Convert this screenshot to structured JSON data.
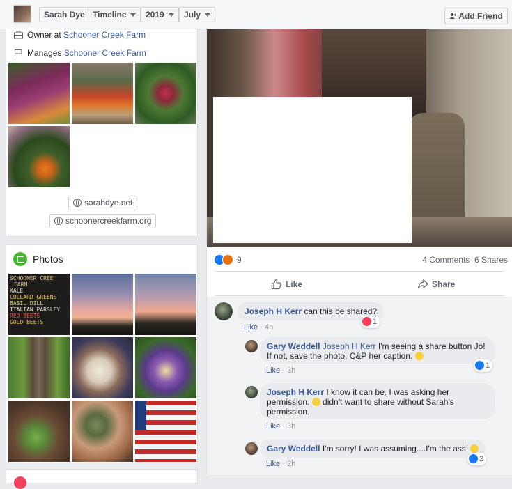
{
  "topbar": {
    "name": "Sarah Dye",
    "section": "Timeline",
    "year": "2019",
    "month": "July",
    "add_friend_label": "Add Friend"
  },
  "intro": {
    "owner_prefix": "Owner at",
    "owner_link": "Schooner Creek Farm",
    "manages_prefix": "Manages",
    "manages_link": "Schooner Creek Farm",
    "websites": [
      "sarahdye.net",
      "schoonercreekfarm.org"
    ]
  },
  "photos": {
    "title": "Photos",
    "sign_lines": [
      "SCHOONER CREE",
      "FARM",
      "KALE",
      "COLLARD GREENS",
      "BASIL  DILL",
      "ITALIAN PARSLEY",
      "RED BEETS",
      "GOLD BEETS"
    ]
  },
  "post": {
    "reaction_count": "9",
    "comments_count": "4 Comments",
    "shares_count": "6 Shares",
    "like_label": "Like",
    "share_label": "Share"
  },
  "comments": [
    {
      "author": "Joseph H Kerr",
      "text": "can this be shared?",
      "like_label": "Like",
      "time": "4h",
      "reaction_count": "1"
    },
    {
      "author": "Gary Weddell",
      "tag": "Joseph H Kerr",
      "line1_rest": "I'm seeing a share button Jo!",
      "line2": "If not, save the photo, C&P her caption.",
      "like_label": "Like",
      "time": "3h",
      "reaction_count": "1"
    },
    {
      "author": "Joseph H Kerr",
      "line1_rest": "I know it can be. I was asking her",
      "line2": "permission.",
      "line2_rest": "didn't want to share without Sarah's",
      "line3": "permission.",
      "like_label": "Like",
      "time": "3h"
    },
    {
      "author": "Gary Weddell",
      "text": "I'm sorry! I was assuming....I'm the ass!",
      "like_label": "Like",
      "time": "2h",
      "reaction_count": "2"
    }
  ],
  "colors": {
    "link": "#385898",
    "like_blue": "#1877f2",
    "love_red": "#f33e58",
    "angry_orange": "#e9710f",
    "photos_green": "#42b72a"
  }
}
